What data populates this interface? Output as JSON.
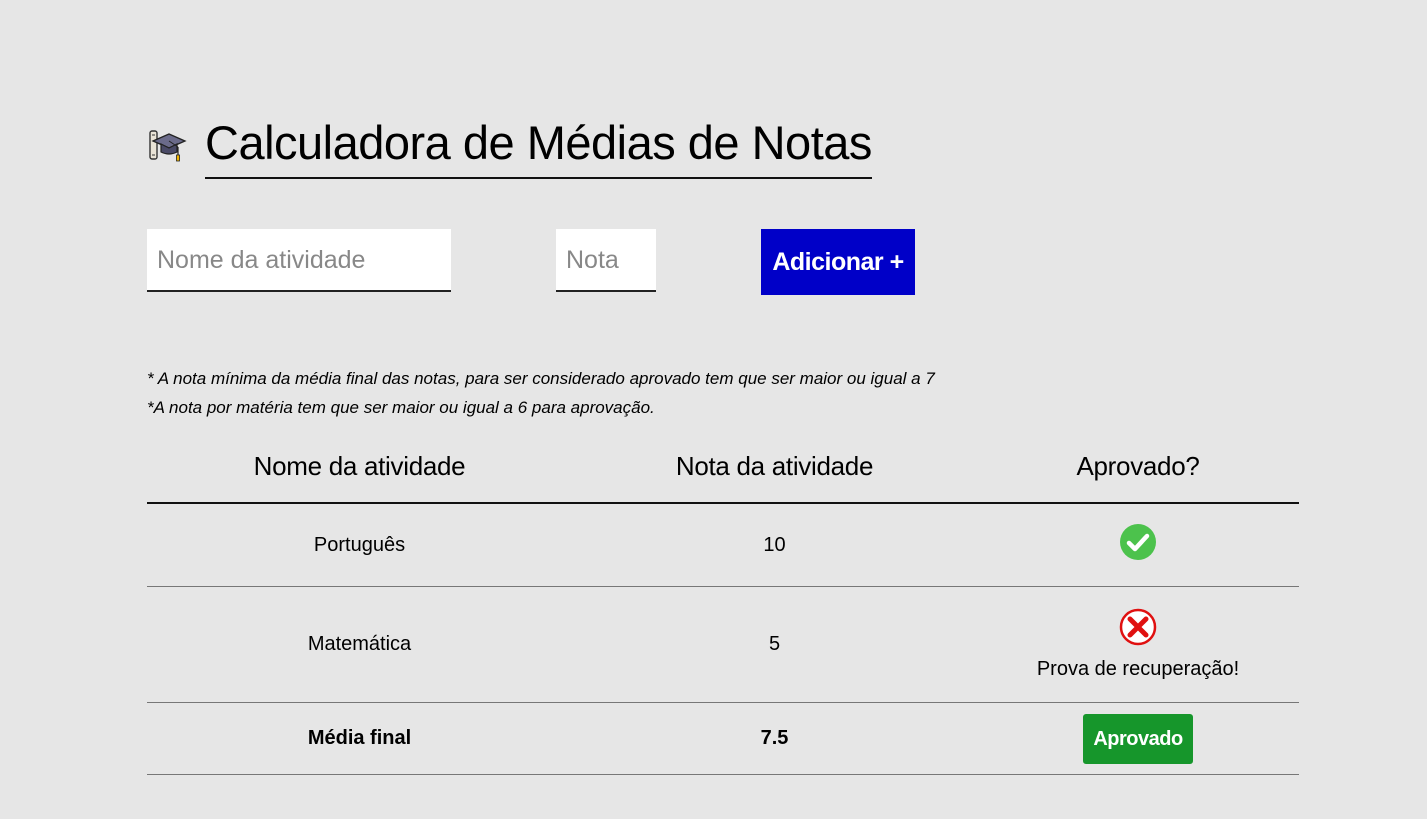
{
  "header": {
    "title": "Calculadora de Médias de Notas",
    "icon": "graduation-cap-icon"
  },
  "form": {
    "activity_placeholder": "Nome da atividade",
    "grade_placeholder": "Nota",
    "add_button_label": "Adicionar +",
    "add_button_color": "#0000c8"
  },
  "notes": {
    "line1": "* A nota mínima da média final das notas, para ser considerado aprovado tem que ser maior ou igual a 7",
    "line2": "*A nota por matéria tem que ser maior ou igual a 6 para aprovação."
  },
  "table": {
    "headers": [
      "Nome da atividade",
      "Nota da atividade",
      "Aprovado?"
    ],
    "rows": [
      {
        "name": "Português",
        "grade": "10",
        "status": "approved",
        "status_icon": "check-icon"
      },
      {
        "name": "Matemática",
        "grade": "5",
        "status": "failed",
        "status_icon": "x-icon",
        "message": "Prova de recuperação!"
      }
    ],
    "footer": {
      "label": "Média final",
      "value": "7.5",
      "result": "Aprovado",
      "result_color": "#16962b"
    }
  }
}
